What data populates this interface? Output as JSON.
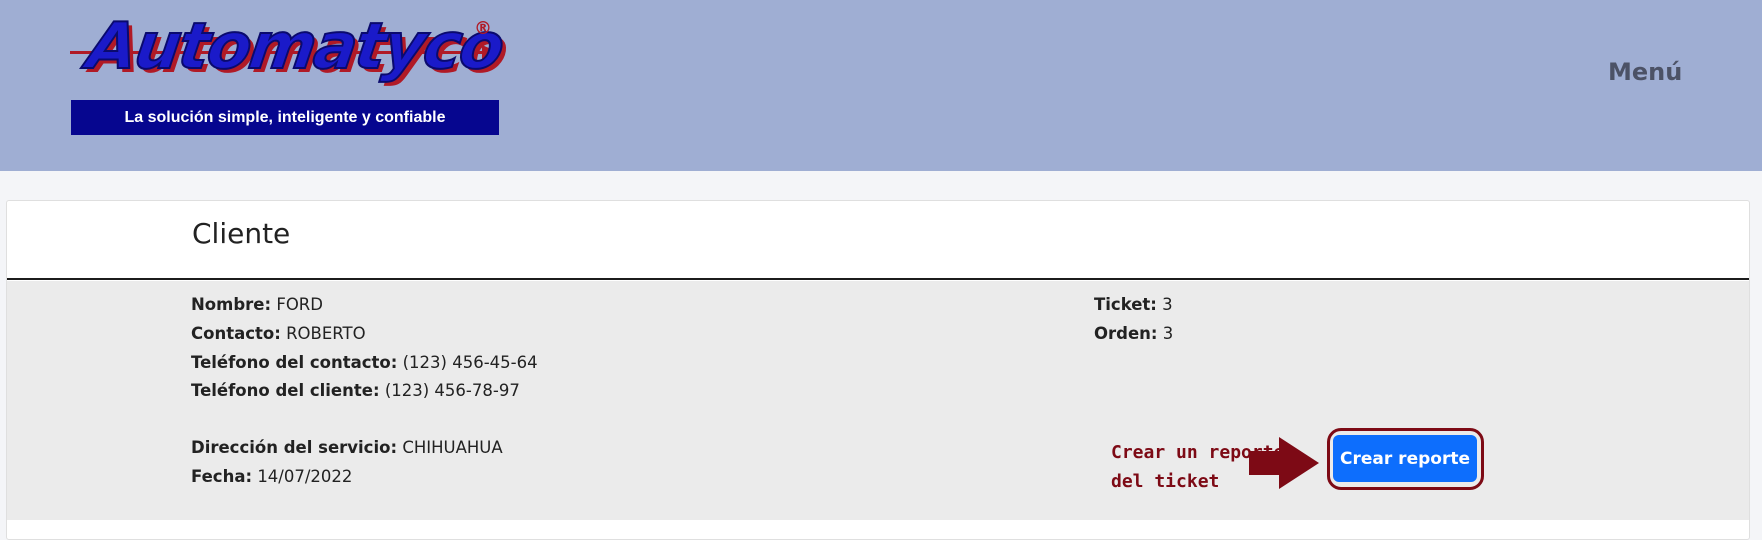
{
  "header": {
    "logo_word": "Automatyco",
    "logo_registered": "®",
    "logo_tagline": "La solución simple, inteligente y confiable",
    "menu_label": "Menú"
  },
  "card": {
    "title": "Cliente",
    "fields": {
      "nombre": {
        "label": "Nombre:",
        "value": "FORD"
      },
      "contacto": {
        "label": "Contacto:",
        "value": "ROBERTO"
      },
      "telefono_contacto": {
        "label": "Teléfono del contacto:",
        "value": "(123) 456-45-64"
      },
      "telefono_cliente": {
        "label": "Teléfono del cliente:",
        "value": "(123) 456-78-97"
      },
      "direccion": {
        "label": "Dirección del servicio:",
        "value": "CHIHUAHUA"
      },
      "fecha": {
        "label": "Fecha:",
        "value": "14/07/2022"
      },
      "ticket": {
        "label": "Ticket:",
        "value": "3"
      },
      "orden": {
        "label": "Orden:",
        "value": "3"
      }
    },
    "create_report_button": "Crear reporte"
  },
  "annotation": {
    "line1": "Crear un reporte",
    "line2": "del ticket",
    "color": "#7d0a15"
  },
  "colors": {
    "header_bg": "#9faed3",
    "button_primary": "#0d6efd",
    "body_bg": "#ebebeb"
  }
}
